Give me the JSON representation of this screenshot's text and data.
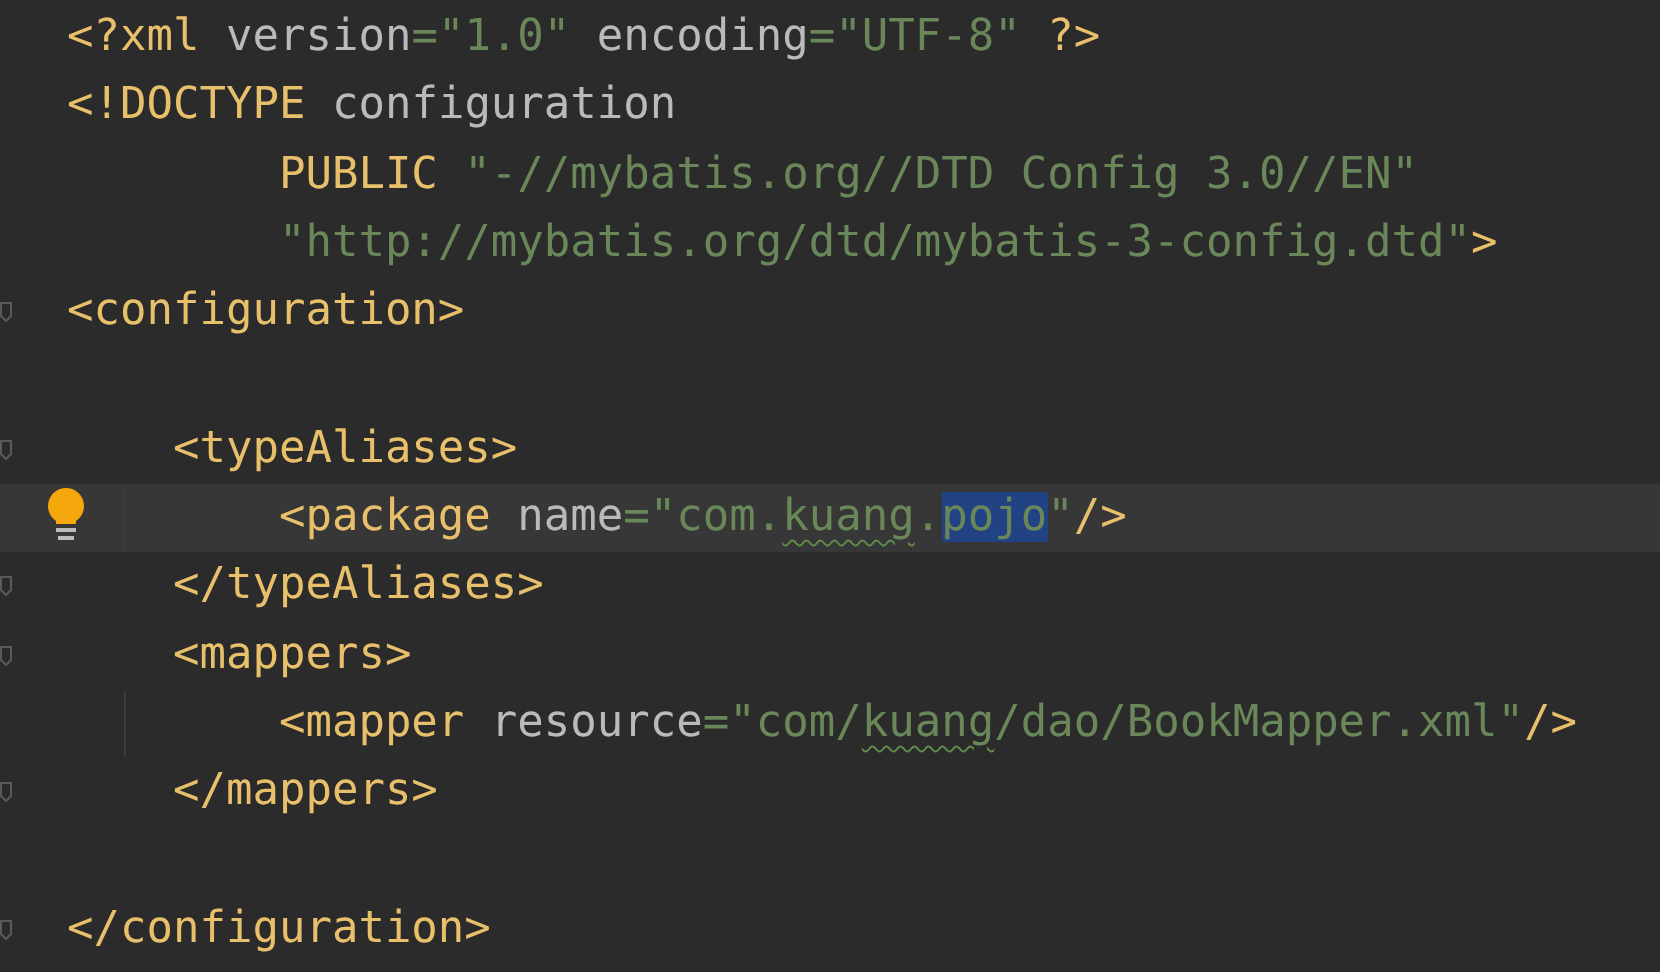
{
  "editor": {
    "lines": [
      {
        "current": false,
        "guide": false,
        "tokens": [
          {
            "kind": "tag",
            "text": "<?xml",
            "selected": false,
            "misspelled": false
          },
          {
            "kind": "attr",
            "text": " version",
            "selected": false,
            "misspelled": false
          },
          {
            "kind": "value",
            "text": "=\"1.0\"",
            "selected": false,
            "misspelled": false
          },
          {
            "kind": "attr",
            "text": " encoding",
            "selected": false,
            "misspelled": false
          },
          {
            "kind": "value",
            "text": "=\"UTF-8\"",
            "selected": false,
            "misspelled": false
          },
          {
            "kind": "tag",
            "text": " ?>",
            "selected": false,
            "misspelled": false
          }
        ]
      },
      {
        "current": false,
        "guide": false,
        "tokens": [
          {
            "kind": "tag",
            "text": "<!DOCTYPE",
            "selected": false,
            "misspelled": false
          },
          {
            "kind": "attr",
            "text": " configuration",
            "selected": false,
            "misspelled": false
          }
        ]
      },
      {
        "current": false,
        "guide": false,
        "tokens": [
          {
            "kind": "tag",
            "text": "        PUBLIC",
            "selected": false,
            "misspelled": false
          },
          {
            "kind": "value",
            "text": " \"-//mybatis.org//DTD Config 3.0//EN\"",
            "selected": false,
            "misspelled": false
          }
        ]
      },
      {
        "current": false,
        "guide": false,
        "tokens": [
          {
            "kind": "value",
            "text": "        \"http://mybatis.org/dtd/mybatis-3-config.dtd\"",
            "selected": false,
            "misspelled": false
          },
          {
            "kind": "tag",
            "text": ">",
            "selected": false,
            "misspelled": false
          }
        ]
      },
      {
        "kind": "fold",
        "current": false,
        "guide": false,
        "tokens": [
          {
            "kind": "tag",
            "text": "<configuration>",
            "selected": false,
            "misspelled": false
          }
        ]
      },
      {
        "current": false,
        "guide": false
      },
      {
        "kind": "fold",
        "current": false,
        "guide": false,
        "tokens": [
          {
            "kind": "tag",
            "text": "    <typeAliases>",
            "selected": false,
            "misspelled": false
          }
        ]
      },
      {
        "kind": "bulb",
        "current": true,
        "guide": true,
        "tokens": [
          {
            "kind": "tag",
            "text": "        <package",
            "selected": false,
            "misspelled": false
          },
          {
            "kind": "attr",
            "text": " name",
            "selected": false,
            "misspelled": false
          },
          {
            "kind": "value",
            "text": "=\"com.",
            "selected": false,
            "misspelled": false
          },
          {
            "kind": "value",
            "text": "kuang",
            "selected": false,
            "misspelled": true
          },
          {
            "kind": "value",
            "text": ".",
            "selected": false,
            "misspelled": false
          },
          {
            "kind": "value",
            "text": "pojo",
            "selected": true,
            "misspelled": false
          },
          {
            "kind": "value",
            "text": "\"",
            "selected": false,
            "misspelled": false
          },
          {
            "kind": "tag",
            "text": "/>",
            "selected": false,
            "misspelled": false
          }
        ]
      },
      {
        "kind": "fold",
        "current": false,
        "guide": false,
        "tokens": [
          {
            "kind": "tag",
            "text": "    </typeAliases>",
            "selected": false,
            "misspelled": false
          }
        ]
      },
      {
        "kind": "fold",
        "current": false,
        "guide": false,
        "tokens": [
          {
            "kind": "tag",
            "text": "    <mappers>",
            "selected": false,
            "misspelled": false
          }
        ]
      },
      {
        "current": false,
        "guide": true,
        "tokens": [
          {
            "kind": "tag",
            "text": "        <mapper",
            "selected": false,
            "misspelled": false
          },
          {
            "kind": "attr",
            "text": " resource",
            "selected": false,
            "misspelled": false
          },
          {
            "kind": "value",
            "text": "=\"com/",
            "selected": false,
            "misspelled": false
          },
          {
            "kind": "value",
            "text": "kuang",
            "selected": false,
            "misspelled": true
          },
          {
            "kind": "value",
            "text": "/dao/BookMapper.xml\"",
            "selected": false,
            "misspelled": false
          },
          {
            "kind": "tag",
            "text": "/>",
            "selected": false,
            "misspelled": false
          }
        ]
      },
      {
        "kind": "fold",
        "current": false,
        "guide": false,
        "tokens": [
          {
            "kind": "tag",
            "text": "    </mappers>",
            "selected": false,
            "misspelled": false
          }
        ]
      },
      {
        "current": false,
        "guide": false
      },
      {
        "kind": "fold",
        "current": false,
        "guide": false,
        "tokens": [
          {
            "kind": "tag",
            "text": "</configuration>",
            "selected": false,
            "misspelled": false
          }
        ]
      }
    ]
  }
}
